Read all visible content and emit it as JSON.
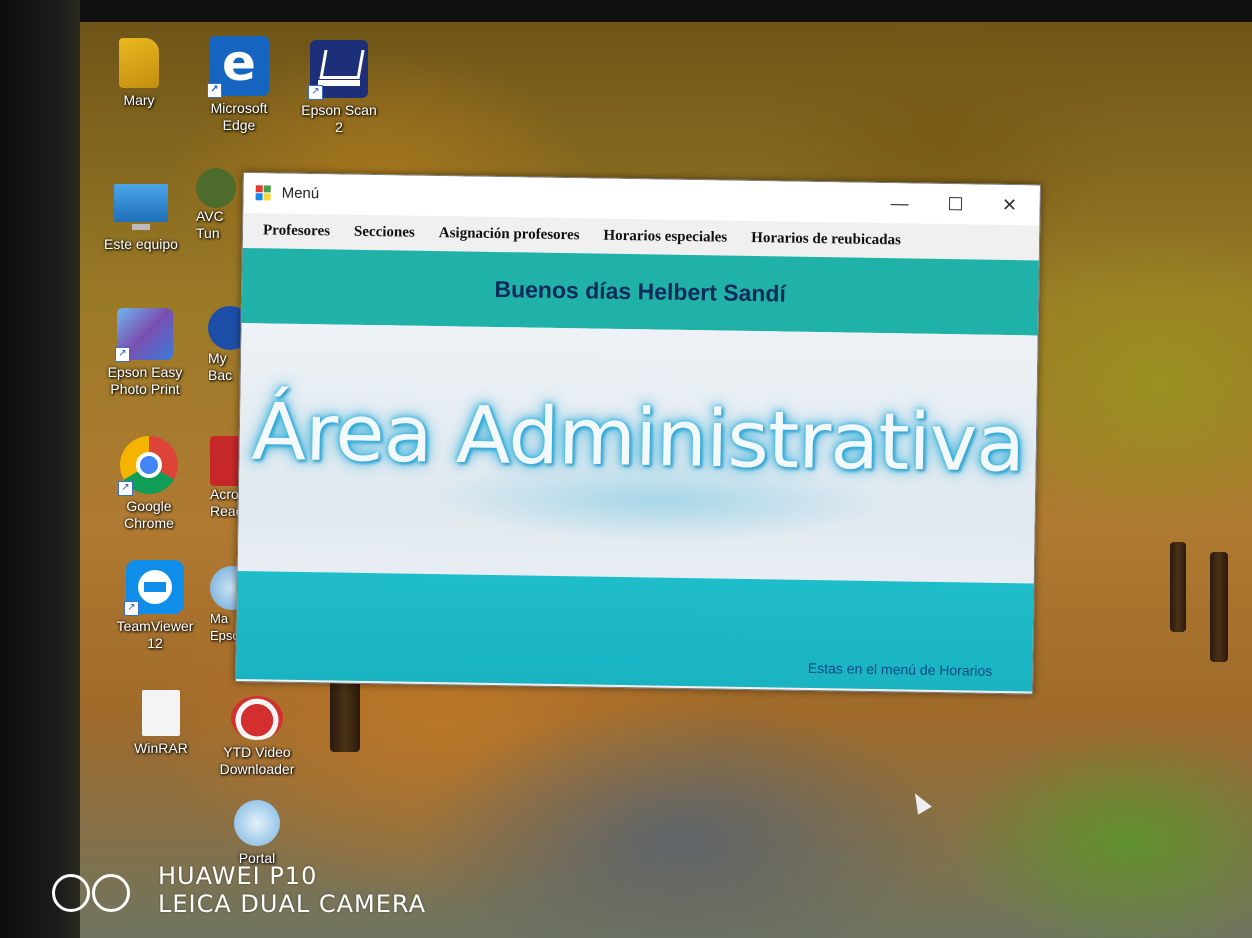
{
  "desktop": {
    "icons": [
      {
        "name": "mary",
        "label": "Mary"
      },
      {
        "name": "microsoft-edge",
        "label": "Microsoft Edge"
      },
      {
        "name": "epson-scan-2",
        "label": "Epson Scan 2"
      },
      {
        "name": "este-equipo",
        "label": "Este equipo"
      },
      {
        "name": "epson-easy-photo-print",
        "label": "Epson Easy Photo Print"
      },
      {
        "name": "google-chrome",
        "label": "Google Chrome"
      },
      {
        "name": "teamviewer-12",
        "label": "TeamViewer 12"
      },
      {
        "name": "winrar",
        "label": "WinRAR"
      },
      {
        "name": "ytd-video-downloader",
        "label": "YTD Video Downloader"
      },
      {
        "name": "avc-tune",
        "label": "AVC Tun"
      },
      {
        "name": "my-backup",
        "label": "My Bac"
      },
      {
        "name": "acrobat-reader",
        "label": "Acro Read"
      },
      {
        "name": "manual-epson",
        "label": "Ma Epson"
      },
      {
        "name": "portal",
        "label": "Portal"
      }
    ]
  },
  "window": {
    "title": "Menú",
    "controls": {
      "minimize": "—",
      "maximize": "☐",
      "close": "✕"
    },
    "menu": [
      "Profesores",
      "Secciones",
      "Asignación profesores",
      "Horarios especiales",
      "Horarios de reubicadas"
    ],
    "greeting": "Buenos días Helbert Sandí",
    "hero_title": "Área Administrativa",
    "status": "Estas en el menú de Horarios"
  },
  "watermark": {
    "line1": "HUAWEI P10",
    "line2": "LEICA DUAL CAMERA"
  },
  "colors": {
    "teal_band": "#20b2a8",
    "cyan_band": "#1fbcc9",
    "greeting_text": "#0e2a5a",
    "status_text": "#0d4a86"
  }
}
